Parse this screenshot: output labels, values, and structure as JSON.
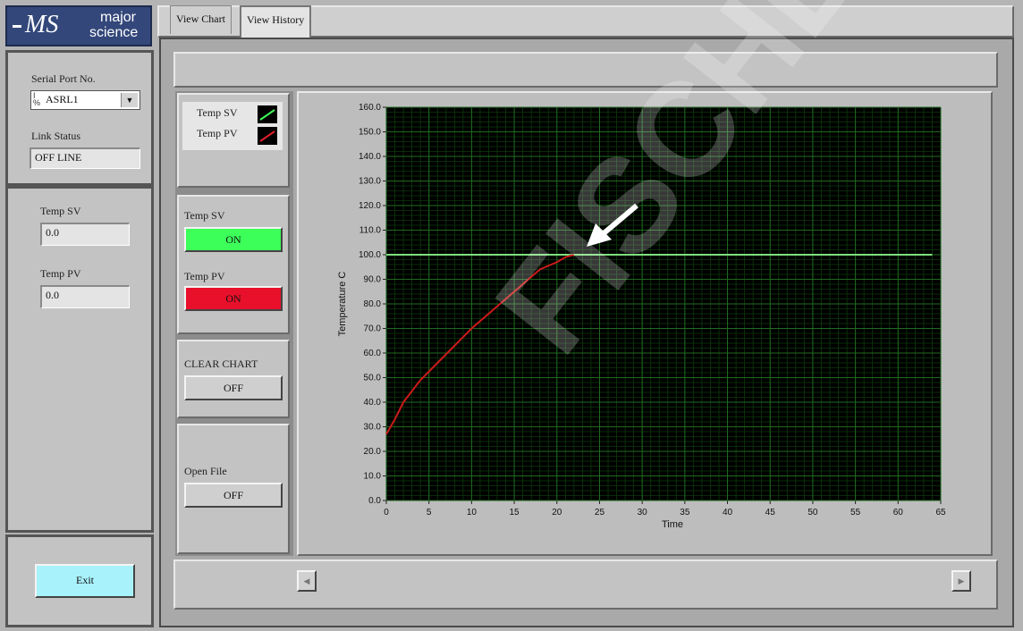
{
  "logo": {
    "mark": "MS",
    "line1": "major",
    "line2": "science"
  },
  "tabs": [
    {
      "label": "View Chart"
    },
    {
      "label": "View History"
    }
  ],
  "serial": {
    "label": "Serial Port No.",
    "value": "ASRL1",
    "link_status_label": "Link Status",
    "link_status_value": "OFF LINE"
  },
  "readings": {
    "sv_label": "Temp SV",
    "sv_value": "0.0",
    "pv_label": "Temp PV",
    "pv_value": "0.0"
  },
  "legend": {
    "items": [
      {
        "label": "Temp SV",
        "color": "#3cff5a"
      },
      {
        "label": "Temp PV",
        "color": "#e0202a"
      }
    ]
  },
  "toggles": {
    "sv_label": "Temp SV",
    "sv_state": "ON",
    "sv_color": "#3cff5a",
    "pv_label": "Temp PV",
    "pv_state": "ON",
    "pv_color": "#e8102a",
    "clear_label": "CLEAR CHART",
    "clear_state": "OFF",
    "open_label": "Open File",
    "open_state": "OFF"
  },
  "exit_label": "Exit",
  "scroll": {
    "left_arrow": "◀",
    "right_arrow": "▶"
  },
  "watermark": "FISCHER SCI",
  "chart_data": {
    "type": "line",
    "xlabel": "Time",
    "ylabel": "Temperature C",
    "xlim": [
      0,
      65
    ],
    "ylim": [
      0,
      160
    ],
    "x_ticks": [
      "0",
      "5",
      "10",
      "15",
      "20",
      "25",
      "30",
      "35",
      "40",
      "45",
      "50",
      "55",
      "60",
      "65"
    ],
    "y_ticks": [
      "0.0",
      "10.0",
      "20.0",
      "30.0",
      "40.0",
      "50.0",
      "60.0",
      "70.0",
      "80.0",
      "90.0",
      "100.0",
      "110.0",
      "120.0",
      "130.0",
      "140.0",
      "150.0",
      "160.0"
    ],
    "grid": true,
    "background": "#000000",
    "series": [
      {
        "name": "Temp SV",
        "color": "#7fe07f",
        "x": [
          0,
          64
        ],
        "y": [
          100,
          100
        ]
      },
      {
        "name": "Temp PV",
        "color": "#cc1a1a",
        "x": [
          0,
          1,
          2,
          4,
          6,
          8,
          10,
          12,
          14,
          16,
          18,
          20,
          21,
          22
        ],
        "y": [
          27,
          33,
          40,
          49,
          56,
          63,
          70,
          76,
          82,
          88,
          94,
          97,
          99,
          100
        ]
      }
    ]
  }
}
